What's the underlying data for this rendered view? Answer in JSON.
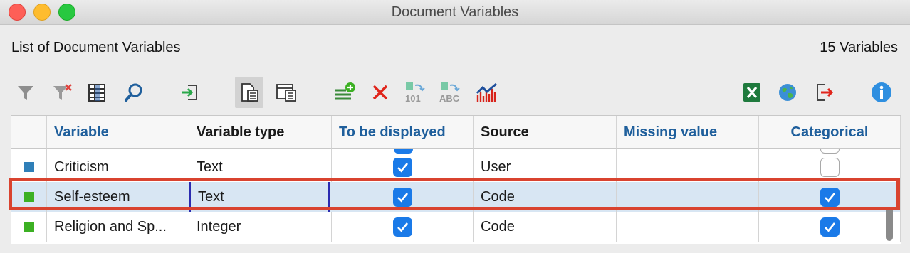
{
  "window": {
    "title": "Document Variables"
  },
  "header": {
    "list_title": "List of Document Variables",
    "count": "15 Variables"
  },
  "toolbar": {
    "icons": [
      "filter-icon",
      "clear-filter-icon",
      "columns-icon",
      "search-icon",
      "import-icon",
      "document-variables-icon",
      "code-variables-icon",
      "add-variable-icon",
      "delete-icon",
      "convert-to-number-icon",
      "convert-to-text-icon",
      "statistics-icon",
      "excel-export-icon",
      "web-export-icon",
      "export-icon",
      "info-icon"
    ],
    "active": "document-variables-icon"
  },
  "table": {
    "columns": [
      {
        "label": "Variable",
        "color": "blue"
      },
      {
        "label": "Variable type",
        "color": "dark"
      },
      {
        "label": "To be displayed",
        "color": "blue"
      },
      {
        "label": "Source",
        "color": "dark"
      },
      {
        "label": "Missing value",
        "color": "blue"
      },
      {
        "label": "Categorical",
        "color": "blue"
      }
    ],
    "rows": [
      {
        "color": "#2f7fb8",
        "variable": "Criticism",
        "type": "Text",
        "displayed": true,
        "source": "User",
        "missing": "",
        "categorical": false
      },
      {
        "color": "#3cb023",
        "variable": "Self-esteem",
        "type": "Text",
        "displayed": true,
        "source": "Code",
        "missing": "",
        "categorical": true,
        "selected": true
      },
      {
        "color": "#3cb023",
        "variable": "Religion and Sp...",
        "type": "Integer",
        "displayed": true,
        "source": "Code",
        "missing": "",
        "categorical": true
      }
    ]
  },
  "colors": {
    "accent": "#1a7ae8",
    "highlight": "#d9432f",
    "header_blue": "#1f5f9c"
  }
}
